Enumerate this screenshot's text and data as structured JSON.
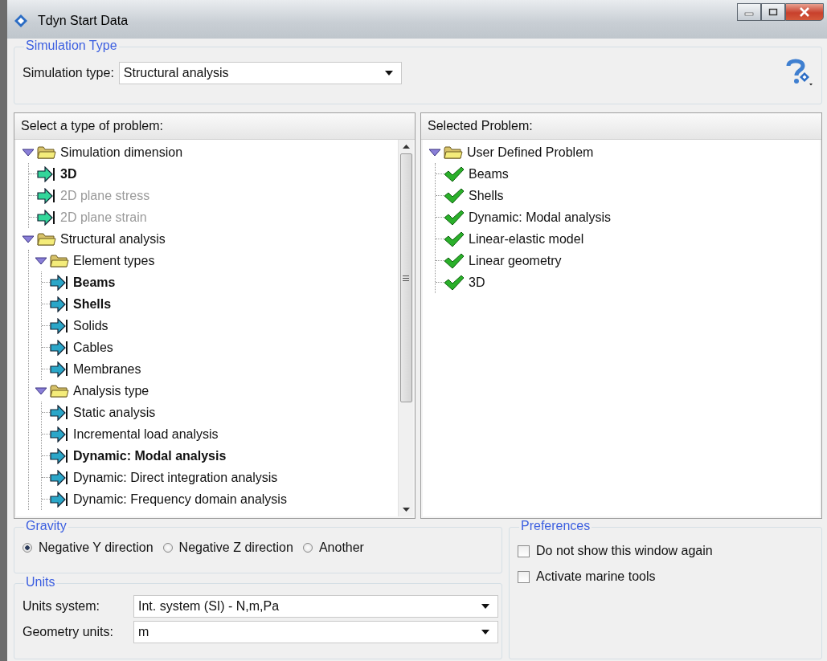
{
  "window": {
    "title": "Tdyn Start Data"
  },
  "simulation_type": {
    "title": "Simulation Type",
    "label": "Simulation type:",
    "value": "Structural analysis"
  },
  "problem_types": {
    "title": "Select a type of problem:",
    "tree": [
      {
        "label": "Simulation dimension",
        "kind": "folder",
        "expanded": true,
        "selected": false,
        "disabled": false,
        "children": [
          {
            "label": "3D",
            "kind": "arrow",
            "color": "#33d69a",
            "selected": true,
            "disabled": false
          },
          {
            "label": "2D plane stress",
            "kind": "arrow",
            "color": "#33d69a",
            "selected": false,
            "disabled": true
          },
          {
            "label": "2D plane strain",
            "kind": "arrow",
            "color": "#33d69a",
            "selected": false,
            "disabled": true
          }
        ]
      },
      {
        "label": "Structural analysis",
        "kind": "folder",
        "expanded": true,
        "selected": false,
        "disabled": false,
        "children": [
          {
            "label": "Element types",
            "kind": "folder",
            "expanded": true,
            "selected": false,
            "disabled": false,
            "children": [
              {
                "label": "Beams",
                "kind": "arrow",
                "color": "#2aa6c8",
                "selected": true,
                "disabled": false
              },
              {
                "label": "Shells",
                "kind": "arrow",
                "color": "#2aa6c8",
                "selected": true,
                "disabled": false
              },
              {
                "label": "Solids",
                "kind": "arrow",
                "color": "#2aa6c8",
                "selected": false,
                "disabled": false
              },
              {
                "label": "Cables",
                "kind": "arrow",
                "color": "#2aa6c8",
                "selected": false,
                "disabled": false
              },
              {
                "label": "Membranes",
                "kind": "arrow",
                "color": "#2aa6c8",
                "selected": false,
                "disabled": false
              }
            ]
          },
          {
            "label": "Analysis type",
            "kind": "folder",
            "expanded": true,
            "selected": false,
            "disabled": false,
            "children": [
              {
                "label": "Static analysis",
                "kind": "arrow",
                "color": "#2aa6c8",
                "selected": false,
                "disabled": false
              },
              {
                "label": "Incremental load analysis",
                "kind": "arrow",
                "color": "#2aa6c8",
                "selected": false,
                "disabled": false
              },
              {
                "label": "Dynamic: Modal analysis",
                "kind": "arrow",
                "color": "#2aa6c8",
                "selected": true,
                "disabled": false
              },
              {
                "label": "Dynamic: Direct integration analysis",
                "kind": "arrow",
                "color": "#2aa6c8",
                "selected": false,
                "disabled": false
              },
              {
                "label": "Dynamic: Frequency domain analysis",
                "kind": "arrow",
                "color": "#2aa6c8",
                "selected": false,
                "disabled": false
              }
            ]
          }
        ]
      }
    ]
  },
  "selected_problem": {
    "title": "Selected Problem:",
    "tree": [
      {
        "label": "User Defined Problem",
        "kind": "folder",
        "expanded": true,
        "children": [
          {
            "label": "Beams",
            "kind": "check"
          },
          {
            "label": "Shells",
            "kind": "check"
          },
          {
            "label": "Dynamic: Modal analysis",
            "kind": "check"
          },
          {
            "label": "Linear-elastic model",
            "kind": "check"
          },
          {
            "label": "Linear geometry",
            "kind": "check"
          },
          {
            "label": "3D",
            "kind": "check"
          }
        ]
      }
    ]
  },
  "gravity": {
    "title": "Gravity",
    "options": [
      {
        "label": "Negative Y direction",
        "selected": true
      },
      {
        "label": "Negative Z direction",
        "selected": false
      },
      {
        "label": "Another",
        "selected": false
      }
    ]
  },
  "units": {
    "title": "Units",
    "fields": [
      {
        "label": "Units system:",
        "value": "Int. system (SI) - N,m,Pa"
      },
      {
        "label": "Geometry units:",
        "value": "m"
      }
    ]
  },
  "preferences": {
    "title": "Preferences",
    "options": [
      {
        "label": "Do not show this window again",
        "checked": false
      },
      {
        "label": "Activate marine tools",
        "checked": false
      }
    ]
  }
}
